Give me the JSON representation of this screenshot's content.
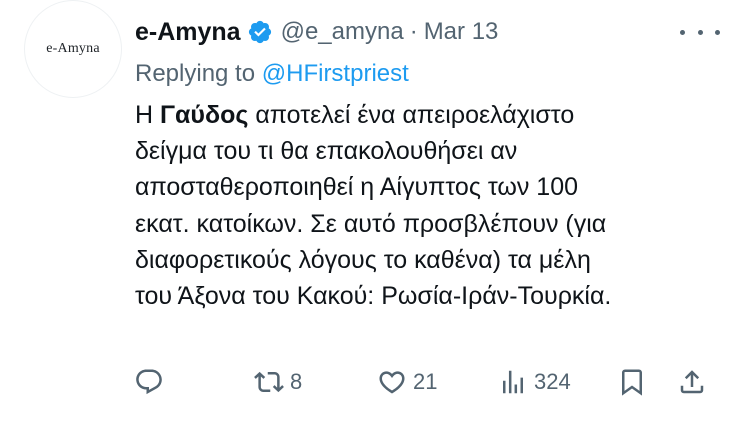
{
  "author": {
    "avatar_text": "e-Amyna",
    "display_name": "e-Amyna",
    "handle": "@e_amyna",
    "separator": "·",
    "date": "Mar 13",
    "verified_icon": "verified-badge-icon",
    "verified_color": "#1d9bf0"
  },
  "reply": {
    "prefix": "Replying to",
    "mention": "@HFirstpriest"
  },
  "body": {
    "l1_pre": "Η ",
    "l1_bold": "Γαύδος",
    "l1_post": " αποτελεί ένα απειροελάχιστο",
    "l2": "δείγμα του τι θα επακολουθήσει αν",
    "l3": "αποσταθεροποιηθεί η Αίγυπτος των 100",
    "l4": "εκατ. κατοίκων. Σε αυτό προσβλέπουν (για",
    "l5": "διαφορετικούς λόγους το καθένα) τα μέλη",
    "l6": "του Άξονα του Κακού: Ρωσία-Ιράν-Τουρκία."
  },
  "actions": {
    "reply_icon": "reply-icon",
    "retweet_icon": "retweet-icon",
    "retweets": "8",
    "like_icon": "heart-icon",
    "likes": "21",
    "views_icon": "views-icon",
    "views": "324",
    "bookmark_icon": "bookmark-icon",
    "share_icon": "share-icon"
  },
  "colors": {
    "text": "#0f1419",
    "secondary": "#536471",
    "accent": "#1d9bf0"
  }
}
